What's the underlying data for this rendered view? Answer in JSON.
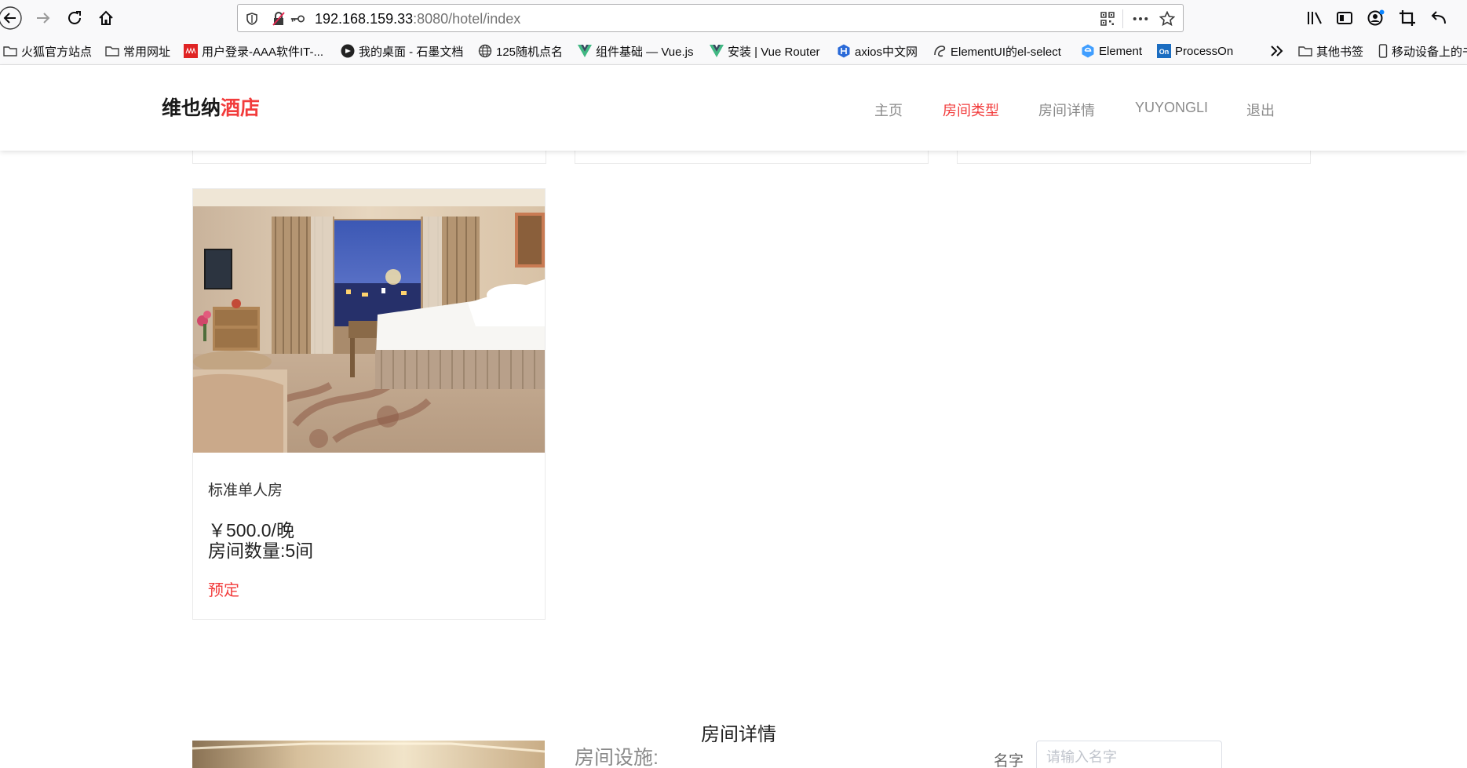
{
  "browser": {
    "url_host": "192.168.159.33",
    "url_rest": ":8080/hotel/index",
    "bookmarks": [
      {
        "label": "火狐官方站点",
        "icon": "folder-icon"
      },
      {
        "label": "常用网址",
        "icon": "folder-icon"
      },
      {
        "label": "用户登录-AAA软件IT-...",
        "icon": "aaa-favicon"
      },
      {
        "label": "我的桌面 - 石墨文档",
        "icon": "shimo-favicon"
      },
      {
        "label": "125随机点名",
        "icon": "globe-icon"
      },
      {
        "label": "组件基础 — Vue.js",
        "icon": "vue-favicon"
      },
      {
        "label": "安装 | Vue Router",
        "icon": "vue-favicon"
      },
      {
        "label": "axios中文网",
        "icon": "hexagon-h-favicon"
      },
      {
        "label": "ElementUI的el-select",
        "icon": "script-favicon"
      },
      {
        "label": "Element",
        "icon": "element-favicon"
      },
      {
        "label": "ProcessOn",
        "icon": "processon-favicon"
      },
      {
        "label": "其他书签",
        "icon": "folder-icon"
      },
      {
        "label": "移动设备上的书",
        "icon": "mobile-icon"
      }
    ],
    "colors": {
      "chrome_bg": "#f9f9fa",
      "vue_green": "#41b883",
      "aaa_red": "#e02424",
      "processon_blue": "#1b6dc1"
    }
  },
  "site": {
    "logo_main": "维也纳",
    "logo_accent": "酒店",
    "accent_color": "#f23c3c",
    "nav": [
      {
        "label": "主页",
        "active": false
      },
      {
        "label": "房间类型",
        "active": true
      },
      {
        "label": "房间详情",
        "active": false
      },
      {
        "label": "YUYONGLI",
        "active": false
      },
      {
        "label": "退出",
        "active": false
      }
    ]
  },
  "room": {
    "name": "标准单人房",
    "price": "￥500.0/晚",
    "count": "房间数量:5间",
    "book_label": "预定"
  },
  "details": {
    "title": "房间详情",
    "facility_label": "房间设施:",
    "name_label": "名字",
    "name_placeholder": "请输入名字"
  }
}
